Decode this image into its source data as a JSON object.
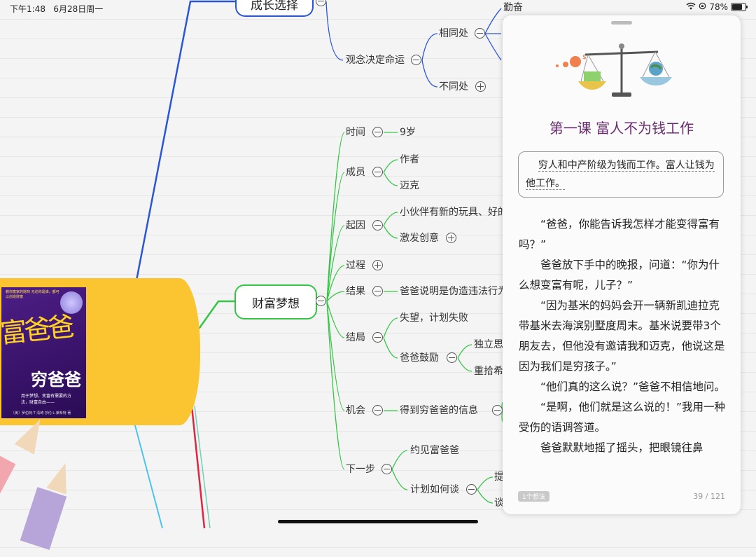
{
  "status_bar": {
    "time": "下午1:48",
    "date": "6月28日周一",
    "battery_percent": "78%",
    "battery_level": 0.78
  },
  "mindmap": {
    "top_branch": {
      "label": "成长选择",
      "child": "观念决定命运",
      "grandchildren": [
        {
          "label": "相同处",
          "expanded": true,
          "child": "勤奋"
        },
        {
          "label": "不同处",
          "expanded": false
        }
      ]
    },
    "center_branch": {
      "label": "财富梦想",
      "children": [
        {
          "label": "时间",
          "child": "9岁"
        },
        {
          "label": "成员",
          "children": [
            "作者",
            "迈克"
          ]
        },
        {
          "label": "起因",
          "children": [
            "小伙伴有新的玩具、好的",
            "激发创意"
          ]
        },
        {
          "label": "过程"
        },
        {
          "label": "结果",
          "child": "爸爸说明是伪造违法行为"
        },
        {
          "label": "结局",
          "children": [
            "失望，计划失败",
            "爸爸鼓励"
          ],
          "grandchildren": [
            "独立思",
            "重拾希"
          ]
        },
        {
          "label": "机会",
          "child": "得到穷爸爸的信息"
        },
        {
          "label": "下一步",
          "children": [
            "约见富爸爸",
            "计划如何谈"
          ],
          "grandchildren": [
            "提",
            "谈"
          ]
        }
      ]
    },
    "book": {
      "title_main": "富爸爸",
      "title_sub": "穷爸爸",
      "blurb": "教你富家的财商 无论你是谁，都可以创造财富",
      "subtitle": "用于梦想，变富有需要的方法，财富自由——",
      "author": "〔美〕罗伯特·T·清崎 莎伦·L·莱希特 著"
    }
  },
  "reader": {
    "lesson_title": "第一课 富人不为钱工作",
    "quote": "穷人和中产阶级为钱而工作。富人让钱为他工作。",
    "paragraphs": [
      "“爸爸，你能告诉我怎样才能变得富有吗？”",
      "爸爸放下手中的晚报，问道：“你为什么想变富有呢，儿子？”",
      "“因为基米的妈妈会开一辆新凯迪拉克带基米去海滨别墅度周末。基米说要带3个朋友去，但他没有邀请我和迈克，他说这是因为我们是穷孩子。”",
      "“他们真的这么说？”爸爸不相信地问。",
      "“是啊，他们就是这么说的！”我用一种受伤的语调答道。",
      "爸爸默默地摇了摇头，把眼镜往鼻"
    ],
    "thoughts_badge": "1个想法",
    "page_indicator": "39 / 121"
  },
  "colors": {
    "green": "#35c545",
    "blue": "#2a56d6",
    "cyan": "#4cc4ee",
    "red": "#e0263f",
    "root_yellow": "#fbc532",
    "title_purple": "#6a2c6f"
  }
}
